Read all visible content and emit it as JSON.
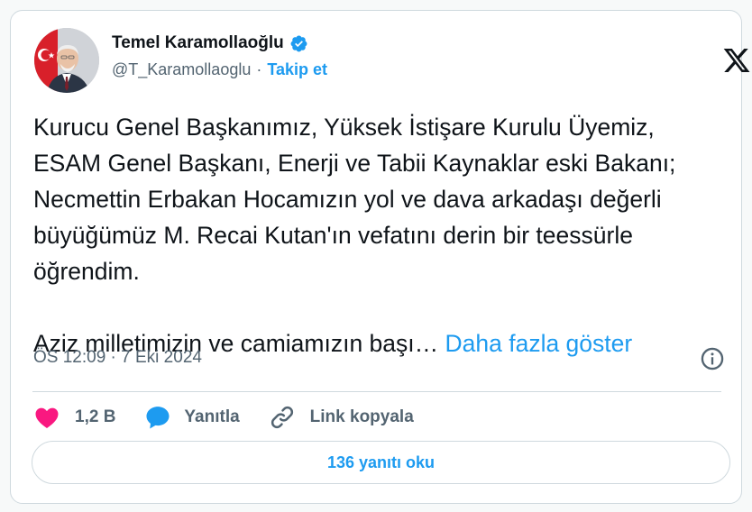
{
  "author": {
    "display_name": "Temel Karamollaoğlu",
    "handle": "@T_Karamollaoglu",
    "separator": "·",
    "follow_label": "Takip et",
    "verified": true
  },
  "tweet": {
    "text": "Kurucu Genel Başkanımız, Yüksek İstişare Kurulu Üyemiz,\nESAM Genel Başkanı, Enerji ve Tabii Kaynaklar eski Bakanı;\nNecmettin Erbakan Hocamızın yol ve dava arkadaşı değerli\nbüyüğümüz M. Recai Kutan'ın vefatını derin bir teessürle\nöğrendim.\n\nAziz milletimizin ve camiamızın başı… ",
    "show_more_label": "Daha fazla göster",
    "timestamp": "ÖS 12:09 · 7 Eki 2024"
  },
  "actions": {
    "like_count": "1,2 B",
    "reply_label": "Yanıtla",
    "copy_link_label": "Link kopyala"
  },
  "read_replies_label": "136 yanıtı oku",
  "icons": {
    "verified": "verified-badge-icon",
    "platform": "x-logo-icon",
    "info": "info-icon",
    "like": "heart-icon",
    "reply": "speech-bubble-icon",
    "link": "link-icon"
  },
  "colors": {
    "accent": "#1d9bf0",
    "like": "#f91880",
    "muted": "#536471",
    "text": "#0f1419",
    "border": "#cfd9de"
  }
}
